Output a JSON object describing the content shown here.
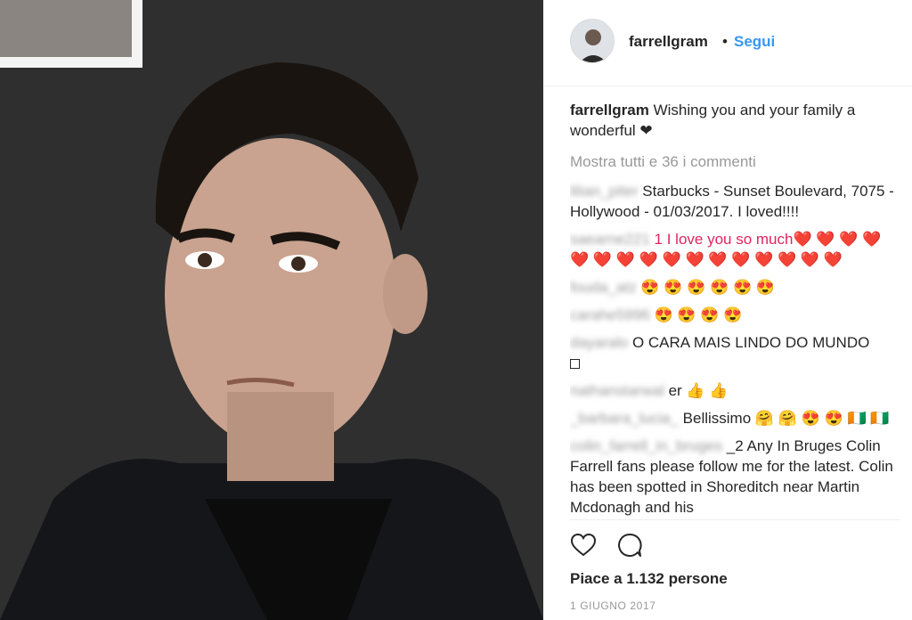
{
  "post": {
    "username": "farrellgram",
    "dot": "•",
    "follow_label": "Segui",
    "caption": "Wishing you and your family a wonderful ❤",
    "view_all": "Mostra tutti e 36 i commenti",
    "comments": [
      {
        "user": "lilian_piter",
        "text": "Starbucks - Sunset Boulevard, 7075 - Hollywood - 01/03/2017. I loved!!!!"
      },
      {
        "user": "saearne221",
        "text": "1 I love you so much❤️ ❤️ ❤️ ❤️ ❤️ ❤️ ❤️ ❤️ ❤️ ❤️ ❤️ ❤️ ❤️ ❤️ ❤️ ❤️"
      },
      {
        "user": "fouda_atz",
        "text": "😍 😍 😍 😍 😍 😍"
      },
      {
        "user": "carahe5996",
        "text": "😍 😍 😍 😍"
      },
      {
        "user": "dayaralo",
        "text": "O CARA MAIS LINDO DO MUNDO"
      },
      {
        "user": "nathanstarwal",
        "text": "er 👍  👍"
      },
      {
        "user": "_barbara_lucia_",
        "text": "Bellissimo 🤗 🤗 😍 😍 🇨🇮 🇨🇮"
      },
      {
        "user": "colin_farrell_in_bruges",
        "text": "_2 Any In Bruges Colin Farrell fans please follow me for the latest. Colin has been spotted in Shoreditch near Martin Mcdonagh and his"
      }
    ],
    "likes": "Piace a 1.132 persone",
    "date": "1 GIUGNO 2017"
  },
  "icons": {
    "like": "heart-outline-icon",
    "comment": "speech-bubble-icon"
  }
}
